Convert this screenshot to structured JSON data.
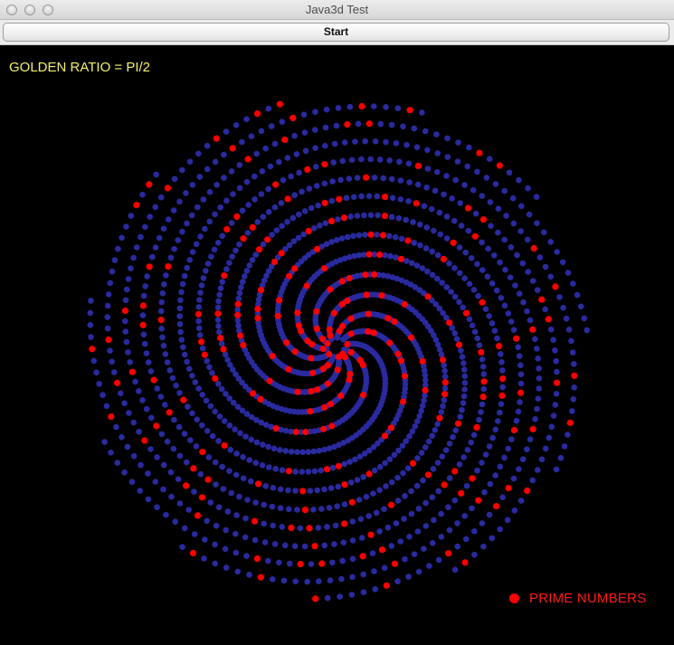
{
  "window": {
    "title": "Java3d Test"
  },
  "toolbar": {
    "start_label": "Start"
  },
  "scene": {
    "ratio_label": "GOLDEN RATIO = PI/2",
    "legend_label": "PRIME NUMBERS",
    "colors": {
      "background": "#000000",
      "point": "#2a2aa0",
      "prime": "#ff0000",
      "ratio_text": "#f5f06a"
    }
  }
}
